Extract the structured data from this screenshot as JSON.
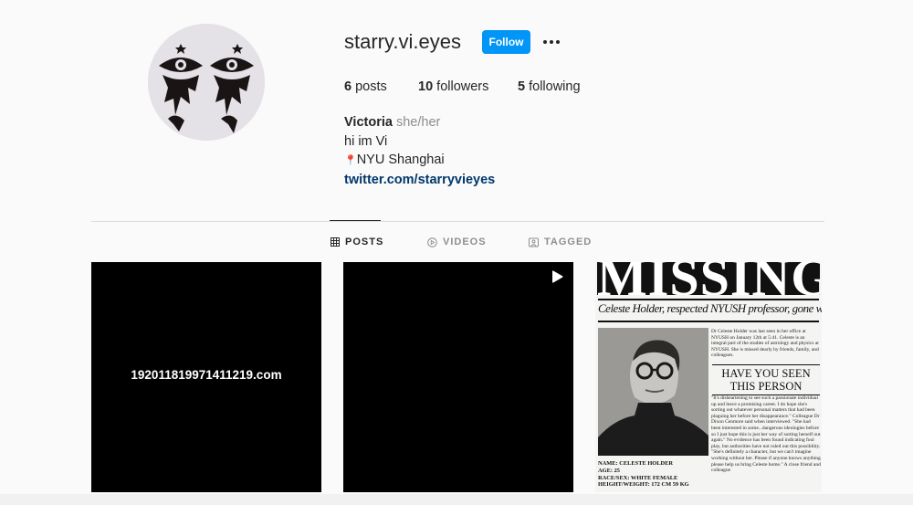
{
  "profile": {
    "username": "starry.vi.eyes",
    "follow_label": "Follow",
    "stats": {
      "posts_count": "6",
      "posts_label": "posts",
      "followers_count": "10",
      "followers_label": "followers",
      "following_count": "5",
      "following_label": "following"
    },
    "bio": {
      "name": "Victoria",
      "pronouns": "she/her",
      "line1": "hi im Vi",
      "location_pin": "📍",
      "location": "NYU Shanghai",
      "link": "twitter.com/starryvieyes"
    }
  },
  "tabs": [
    {
      "label": "POSTS",
      "icon": "grid-icon",
      "active": true
    },
    {
      "label": "VIDEOS",
      "icon": "play-circle-icon",
      "active": false
    },
    {
      "label": "TAGGED",
      "icon": "tag-portrait-icon",
      "active": false
    }
  ],
  "posts": [
    {
      "text": "192011819971411219.com"
    },
    {
      "type": "video",
      "icon": "play-icon"
    },
    {
      "headline": "MISSING",
      "subhead": "Celeste Holder, respected NYUSH professor, gone without a trace",
      "desc": "Dr Celeste Holder was last seen in her office at NYUSH on January 12th at 5:41. Celeste is an integral part of the studies of astrology and physics at NYUSH. She is missed dearly by friends, family, and colleagues.",
      "have_you_seen": "HAVE YOU SEEN THIS PERSON",
      "quote": "\"It's disheartening to see such a passionate individual up and leave a promising career. I do hope she's sorting out whatever personal matters that had been plaguing her before her disappearance.\" Colleague Dr Dixon Cenmore said when interviewed. \"She had been interested in some...dangerous ideologies before so I just hope this is just her way of sorting herself out again.\" No evidence has been found indicating foul play, but authorities have not ruled out this possibility. \"She's definitely a character, but we can't imagine working without her. Please if anyone knows anything please help us bring Celeste home.\" A close friend and colleague",
      "details": [
        "NAME: CELESTE HOLDER",
        "AGE: 25",
        "RACE/SEX: WHITE FEMALE",
        "HEIGHT/WEIGHT: 172 CM 59 KG"
      ]
    }
  ],
  "colors": {
    "accent": "#0095f6",
    "link": "#00376b",
    "background": "#fafafa"
  }
}
